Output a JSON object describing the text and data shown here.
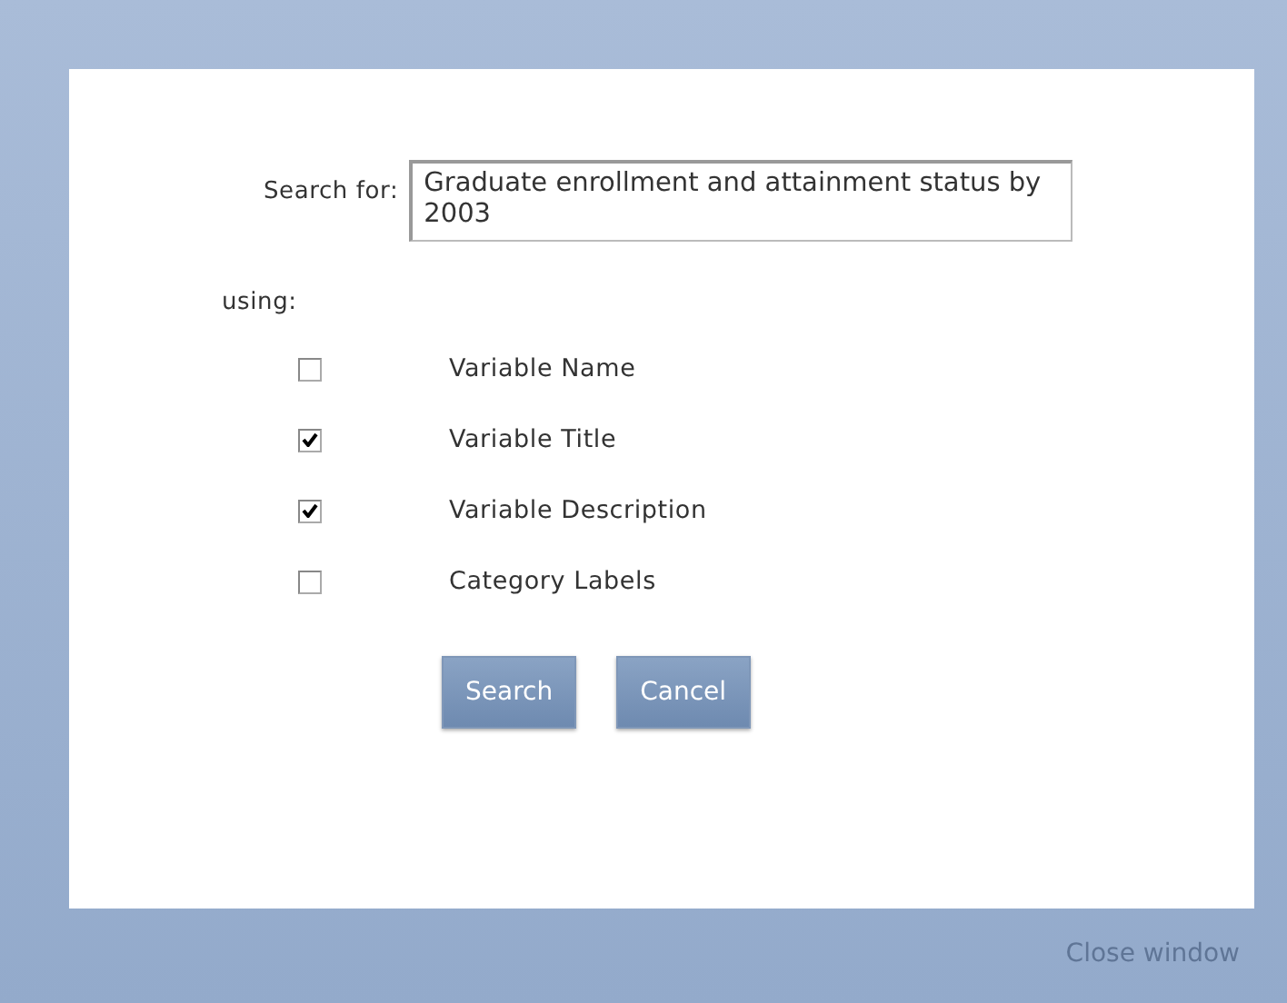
{
  "search": {
    "label": "Search for:",
    "value": "Graduate enrollment and attainment status by 2003"
  },
  "using_label": "using:",
  "options": [
    {
      "label": "Variable Name",
      "checked": false
    },
    {
      "label": "Variable Title",
      "checked": true
    },
    {
      "label": "Variable Description",
      "checked": true
    },
    {
      "label": "Category Labels",
      "checked": false
    }
  ],
  "buttons": [
    "Search",
    "Cancel"
  ],
  "close_link": "Close window"
}
